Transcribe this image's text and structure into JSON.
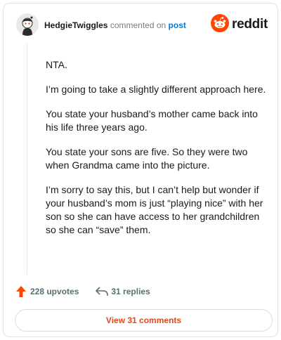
{
  "header": {
    "username": "HedgieTwiggles",
    "action_text": "commented on",
    "post_link": "post",
    "brand_name": "reddit",
    "avatar_icon": "snoo-avatar-icon",
    "brand_icon": "reddit-snoo-logo-icon"
  },
  "comment": {
    "paragraphs": [
      "NTA.",
      "I’m going to take a slightly different approach here.",
      "You state your husband’s mother came back into his life three years ago.",
      "You state your sons are five. So they were two when Grandma came into the picture.",
      "I’m sorry to say this, but I can’t help but wonder if your husband’s mom is just “playing nice” with her son so she can have access to her grandchildren so she can “save” them."
    ]
  },
  "actions": {
    "upvotes_label": "228 upvotes",
    "replies_label": "31 replies",
    "upvote_icon": "upvote-arrow-icon",
    "reply_icon": "reply-arrow-icon"
  },
  "footer": {
    "view_comments_label": "View 31 comments"
  },
  "colors": {
    "accent_orange": "#ff4500",
    "link_blue": "#0079d3",
    "button_text": "#e0481e",
    "meta_gray": "#576f76"
  }
}
